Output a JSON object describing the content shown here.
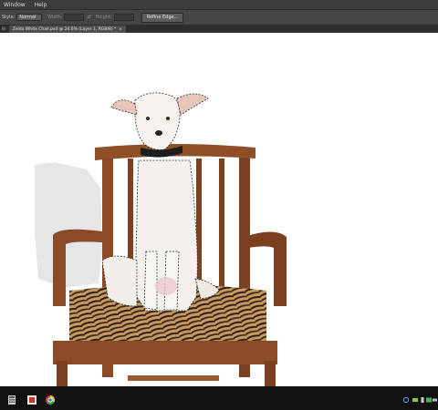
{
  "menu": {
    "items": [
      "Window",
      "Help"
    ]
  },
  "options": {
    "style_label": "Style:",
    "style_value": "Normal",
    "width_label": "Width:",
    "height_label": "Height:",
    "refine_label": "Refine Edge..."
  },
  "tabs": {
    "previous": "8)",
    "active": "Zelda White Chair.psd @ 24.6% (Layer 1, RGB/8) *",
    "close": "×"
  },
  "image": {
    "subject": "dog-on-chair"
  },
  "taskbar": {
    "apps": [
      "calculator-icon",
      "photoshop-icon",
      "browser-icon"
    ],
    "tray": [
      "network-icon",
      "display-icon",
      "phone-icon",
      "tablet-icon",
      "battery-icon"
    ]
  },
  "colors": {
    "accent": "#3c3c3c",
    "chair_wood": "#8a4b26",
    "seat_stripe": "#2a1a10"
  }
}
